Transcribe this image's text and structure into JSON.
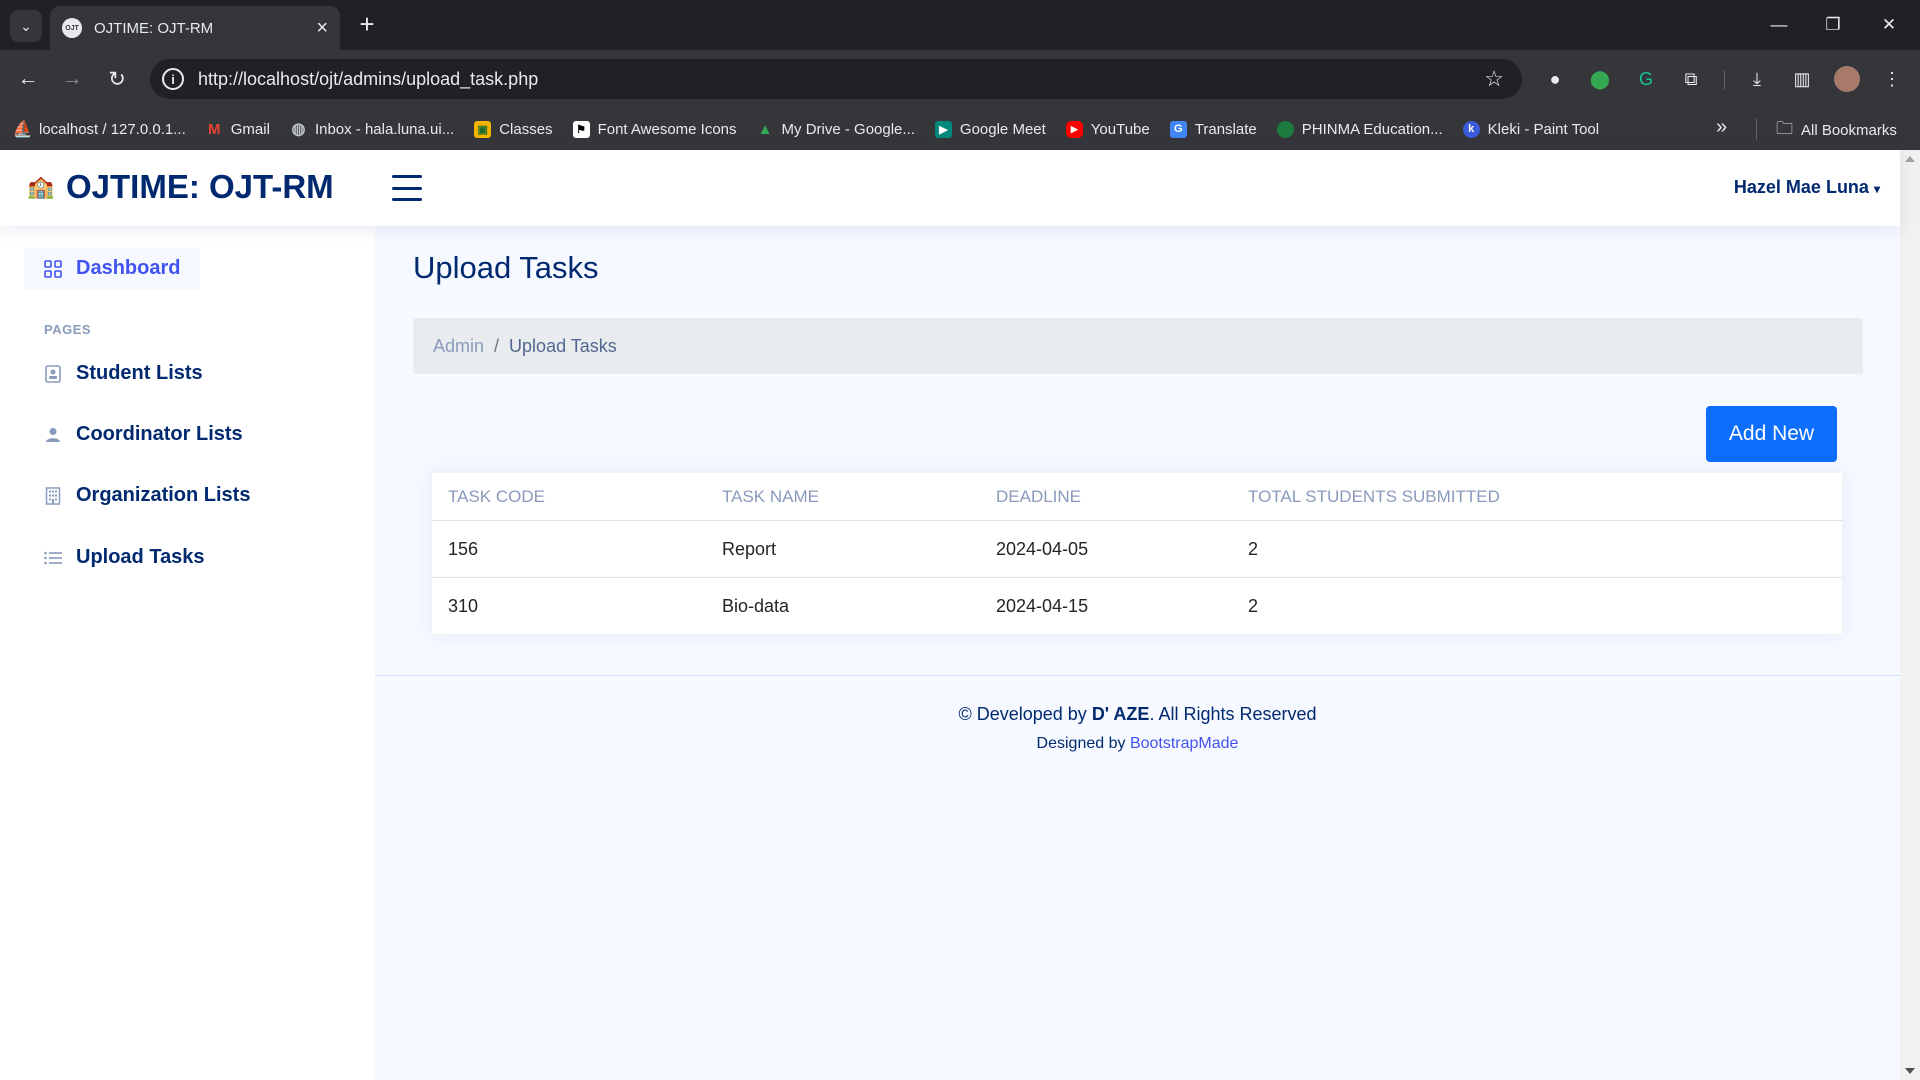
{
  "browser": {
    "tab_title": "OJTIME: OJT-RM",
    "url": "http://localhost/ojt/admins/upload_task.php",
    "bookmarks": [
      {
        "label": "localhost / 127.0.0.1...",
        "icon": "phpmyadmin-icon",
        "color": "#f89c0e"
      },
      {
        "label": "Gmail",
        "icon": "gmail-icon",
        "color": "#ea4335"
      },
      {
        "label": "Inbox - hala.luna.ui...",
        "icon": "globe-icon",
        "color": "#9aa0a6"
      },
      {
        "label": "Classes",
        "icon": "google-classroom-icon",
        "color": "#f4b400"
      },
      {
        "label": "Font Awesome Icons",
        "icon": "flag-icon",
        "color": "#ffffff"
      },
      {
        "label": "My Drive - Google...",
        "icon": "google-drive-icon",
        "color": "#34a853"
      },
      {
        "label": "Google Meet",
        "icon": "google-meet-icon",
        "color": "#00897b"
      },
      {
        "label": "YouTube",
        "icon": "youtube-icon",
        "color": "#ff0000"
      },
      {
        "label": "Translate",
        "icon": "google-translate-icon",
        "color": "#4285f4"
      },
      {
        "label": "PHINMA Education...",
        "icon": "phinma-icon",
        "color": "#1b7a3e"
      },
      {
        "label": "Kleki - Paint Tool",
        "icon": "kleki-icon",
        "color": "#3b5bdb"
      }
    ],
    "all_bookmarks": "All Bookmarks"
  },
  "header": {
    "logo_text": "OJTIME: OJT-RM",
    "user_name": "Hazel Mae Luna"
  },
  "sidebar": {
    "dashboard": "Dashboard",
    "heading": "PAGES",
    "items": [
      {
        "label": "Student Lists",
        "icon": "id-badge-icon"
      },
      {
        "label": "Coordinator Lists",
        "icon": "person-icon"
      },
      {
        "label": "Organization Lists",
        "icon": "building-icon"
      },
      {
        "label": "Upload Tasks",
        "icon": "list-icon"
      }
    ]
  },
  "main": {
    "title": "Upload Tasks",
    "breadcrumb": [
      "Admin",
      "Upload Tasks"
    ],
    "add_button": "Add New",
    "table": {
      "columns": [
        "TASK CODE",
        "TASK NAME",
        "DEADLINE",
        "TOTAL STUDENTS SUBMITTED"
      ],
      "rows": [
        [
          "156",
          "Report",
          "2024-04-05",
          "2"
        ],
        [
          "310",
          "Bio-data",
          "2024-04-15",
          "2"
        ]
      ]
    }
  },
  "footer": {
    "copyright_prefix": "© Developed by ",
    "copyright_brand": "D' AZE",
    "copyright_suffix": ". All Rights Reserved",
    "credits_prefix": "Designed by ",
    "credits_link": "BootstrapMade"
  },
  "colors": {
    "brand_navy": "#012970",
    "accent_blue": "#4154f1",
    "button_blue": "#0d6efd"
  }
}
